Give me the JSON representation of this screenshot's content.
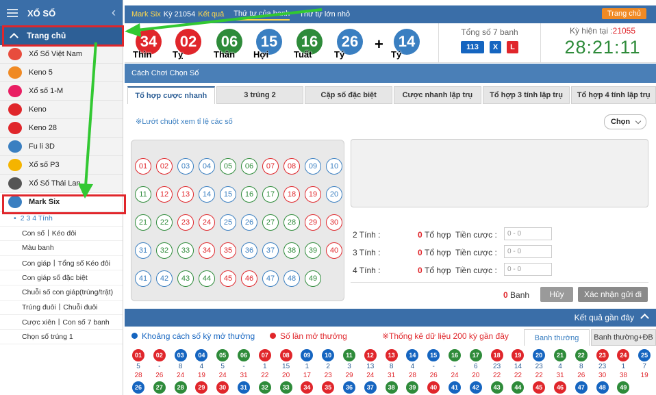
{
  "sidebar": {
    "title": "XỔ SỐ",
    "home": "Trang chủ",
    "items": [
      {
        "label": "Xổ Số Việt Nam",
        "color": "#e84c3d",
        "icon": "vn"
      },
      {
        "label": "Keno 5",
        "color": "#f08a24",
        "icon": "k5"
      },
      {
        "label": "Xổ số 1-M",
        "color": "#e91e63",
        "icon": "1m"
      },
      {
        "label": "Keno",
        "color": "#e0262b",
        "icon": "keno"
      },
      {
        "label": "Keno 28",
        "color": "#e0262b",
        "icon": "k28"
      },
      {
        "label": "Fu li 3D",
        "color": "#3a7fc1",
        "icon": "3d"
      },
      {
        "label": "Xổ số P3",
        "color": "#f5b400",
        "icon": "p3"
      },
      {
        "label": "Xổ Số Thái Lan",
        "color": "#555555",
        "icon": "th"
      },
      {
        "label": "Mark Six",
        "color": "#3a7fc1",
        "icon": "m6"
      }
    ],
    "sub_items": [
      "2 3 4 Tính",
      "Con số丨Kéo đôi",
      "Màu banh",
      "Con giáp丨Tổng số Kéo đôi",
      "Con giáp số đặc biệt",
      "Chuỗi số con giáp(trúng/trật)",
      "Trúng đuôi丨Chuỗi đuôi",
      "Cược xiên丨Con số 7 banh",
      "Chọn số trúng 1"
    ]
  },
  "header": {
    "draw_label": "Mark Six",
    "draw_text": "Kỳ 21054",
    "result_label": "Kết quả",
    "tabs": [
      "Thứ tự của banh",
      "Thứ tự lớn nhỏ"
    ],
    "home_button": "Trang chủ"
  },
  "results": {
    "balls": [
      {
        "num": "34",
        "zodiac": "Thìn",
        "color": "#e0262b"
      },
      {
        "num": "02",
        "zodiac": "Tỵ",
        "color": "#e0262b"
      },
      {
        "num": "06",
        "zodiac": "Thân",
        "color": "#2e8b3a"
      },
      {
        "num": "15",
        "zodiac": "Hợi",
        "color": "#3a7fc1"
      },
      {
        "num": "16",
        "zodiac": "Tuất",
        "color": "#2e8b3a"
      },
      {
        "num": "26",
        "zodiac": "Tý",
        "color": "#3a7fc1"
      }
    ],
    "plus": "+",
    "special": {
      "num": "14",
      "zodiac": "Tý",
      "color": "#3a7fc1"
    },
    "sum_title": "Tổng số 7 banh",
    "sum_values": [
      {
        "text": "113",
        "color": "#1565c0"
      },
      {
        "text": "X",
        "color": "#1565c0"
      },
      {
        "text": "L",
        "color": "#e0262b"
      }
    ],
    "period_label": "Kỳ hiện tại :",
    "period_value": "21055",
    "countdown": "28:21:11"
  },
  "how_to_play": "Cách Chơi Chọn Số",
  "bet_tabs": [
    "Tổ hợp cược nhanh",
    "3 trúng 2",
    "Cặp số đặc biệt",
    "Cược nhanh lập trụ",
    "Tổ hợp 3 tính lập trụ",
    "Tổ hợp 4 tính lập trụ"
  ],
  "hover_note": "※Lướt chuột xem tỉ lệ các số",
  "choose_label": "Chọn",
  "numbers": [
    [
      "01",
      "r"
    ],
    [
      "02",
      "r"
    ],
    [
      "03",
      "b"
    ],
    [
      "04",
      "b"
    ],
    [
      "05",
      "g"
    ],
    [
      "06",
      "g"
    ],
    [
      "07",
      "r"
    ],
    [
      "08",
      "r"
    ],
    [
      "09",
      "b"
    ],
    [
      "10",
      "b"
    ],
    [
      "11",
      "g"
    ],
    [
      "12",
      "r"
    ],
    [
      "13",
      "r"
    ],
    [
      "14",
      "b"
    ],
    [
      "15",
      "b"
    ],
    [
      "16",
      "g"
    ],
    [
      "17",
      "g"
    ],
    [
      "18",
      "r"
    ],
    [
      "19",
      "r"
    ],
    [
      "20",
      "b"
    ],
    [
      "21",
      "g"
    ],
    [
      "22",
      "g"
    ],
    [
      "23",
      "r"
    ],
    [
      "24",
      "r"
    ],
    [
      "25",
      "b"
    ],
    [
      "26",
      "b"
    ],
    [
      "27",
      "g"
    ],
    [
      "28",
      "g"
    ],
    [
      "29",
      "r"
    ],
    [
      "30",
      "r"
    ],
    [
      "31",
      "b"
    ],
    [
      "32",
      "g"
    ],
    [
      "33",
      "g"
    ],
    [
      "34",
      "r"
    ],
    [
      "35",
      "r"
    ],
    [
      "36",
      "b"
    ],
    [
      "37",
      "b"
    ],
    [
      "38",
      "g"
    ],
    [
      "39",
      "g"
    ],
    [
      "40",
      "r"
    ],
    [
      "41",
      "b"
    ],
    [
      "42",
      "b"
    ],
    [
      "43",
      "g"
    ],
    [
      "44",
      "g"
    ],
    [
      "45",
      "r"
    ],
    [
      "46",
      "r"
    ],
    [
      "47",
      "b"
    ],
    [
      "48",
      "b"
    ],
    [
      "49",
      "g"
    ]
  ],
  "tinh_rows": [
    {
      "label": "2 Tính :",
      "count": "0",
      "combo": "Tổ hợp",
      "stake": "Tiền cược :",
      "range": "0 - 0"
    },
    {
      "label": "3 Tính :",
      "count": "0",
      "combo": "Tổ hợp",
      "stake": "Tiền cược :",
      "range": "0 - 0"
    },
    {
      "label": "4 Tính :",
      "count": "0",
      "combo": "Tổ hợp",
      "stake": "Tiền cược :",
      "range": "0 - 0"
    }
  ],
  "ticket_count": "0",
  "ticket_unit": "Banh",
  "cancel_button": "Hủy",
  "confirm_button": "Xác nhận gửi đi",
  "recent_title": "Kết quả gần đây",
  "legend": {
    "gap": "Khoảng cách số kỳ mở thưởng",
    "count": "Số lần mở thưởng",
    "stat": "※Thống kê dữ liệu 200 kỳ gần đây",
    "tab_normal": "Banh thường",
    "tab_normal_special": "Banh thường+ĐB"
  },
  "history_row1": [
    {
      "n": "01",
      "c": "#e0262b",
      "gap": "5",
      "cnt": "28"
    },
    {
      "n": "02",
      "c": "#e0262b",
      "gap": "-",
      "cnt": "26"
    },
    {
      "n": "03",
      "c": "#1565c0",
      "gap": "8",
      "cnt": "24"
    },
    {
      "n": "04",
      "c": "#1565c0",
      "gap": "4",
      "cnt": "19"
    },
    {
      "n": "05",
      "c": "#2e8b3a",
      "gap": "5",
      "cnt": "24"
    },
    {
      "n": "06",
      "c": "#2e8b3a",
      "gap": "-",
      "cnt": "31"
    },
    {
      "n": "07",
      "c": "#e0262b",
      "gap": "1",
      "cnt": "22"
    },
    {
      "n": "08",
      "c": "#e0262b",
      "gap": "15",
      "cnt": "20"
    },
    {
      "n": "09",
      "c": "#1565c0",
      "gap": "1",
      "cnt": "17"
    },
    {
      "n": "10",
      "c": "#1565c0",
      "gap": "2",
      "cnt": "23"
    },
    {
      "n": "11",
      "c": "#2e8b3a",
      "gap": "3",
      "cnt": "29"
    },
    {
      "n": "12",
      "c": "#e0262b",
      "gap": "13",
      "cnt": "24"
    },
    {
      "n": "13",
      "c": "#e0262b",
      "gap": "8",
      "cnt": "31"
    },
    {
      "n": "14",
      "c": "#1565c0",
      "gap": "4",
      "cnt": "28"
    },
    {
      "n": "15",
      "c": "#1565c0",
      "gap": "-",
      "cnt": "26"
    },
    {
      "n": "16",
      "c": "#2e8b3a",
      "gap": "-",
      "cnt": "24"
    },
    {
      "n": "17",
      "c": "#2e8b3a",
      "gap": "6",
      "cnt": "20"
    },
    {
      "n": "18",
      "c": "#e0262b",
      "gap": "23",
      "cnt": "22"
    },
    {
      "n": "19",
      "c": "#e0262b",
      "gap": "14",
      "cnt": "22"
    },
    {
      "n": "20",
      "c": "#1565c0",
      "gap": "23",
      "cnt": "22"
    },
    {
      "n": "21",
      "c": "#2e8b3a",
      "gap": "4",
      "cnt": "31"
    },
    {
      "n": "22",
      "c": "#2e8b3a",
      "gap": "8",
      "cnt": "26"
    },
    {
      "n": "23",
      "c": "#e0262b",
      "gap": "23",
      "cnt": "30"
    },
    {
      "n": "24",
      "c": "#e0262b",
      "gap": "1",
      "cnt": "38"
    },
    {
      "n": "25",
      "c": "#1565c0",
      "gap": "7",
      "cnt": "19"
    }
  ],
  "history_row2": [
    {
      "n": "26",
      "c": "#1565c0"
    },
    {
      "n": "27",
      "c": "#2e8b3a"
    },
    {
      "n": "28",
      "c": "#2e8b3a"
    },
    {
      "n": "29",
      "c": "#e0262b"
    },
    {
      "n": "30",
      "c": "#e0262b"
    },
    {
      "n": "31",
      "c": "#1565c0"
    },
    {
      "n": "32",
      "c": "#2e8b3a"
    },
    {
      "n": "33",
      "c": "#2e8b3a"
    },
    {
      "n": "34",
      "c": "#e0262b"
    },
    {
      "n": "35",
      "c": "#e0262b"
    },
    {
      "n": "36",
      "c": "#1565c0"
    },
    {
      "n": "37",
      "c": "#1565c0"
    },
    {
      "n": "38",
      "c": "#2e8b3a"
    },
    {
      "n": "39",
      "c": "#2e8b3a"
    },
    {
      "n": "40",
      "c": "#e0262b"
    },
    {
      "n": "41",
      "c": "#1565c0"
    },
    {
      "n": "42",
      "c": "#1565c0"
    },
    {
      "n": "43",
      "c": "#2e8b3a"
    },
    {
      "n": "44",
      "c": "#2e8b3a"
    },
    {
      "n": "45",
      "c": "#e0262b"
    },
    {
      "n": "46",
      "c": "#e0262b"
    },
    {
      "n": "47",
      "c": "#1565c0"
    },
    {
      "n": "48",
      "c": "#1565c0"
    },
    {
      "n": "49",
      "c": "#2e8b3a"
    }
  ]
}
